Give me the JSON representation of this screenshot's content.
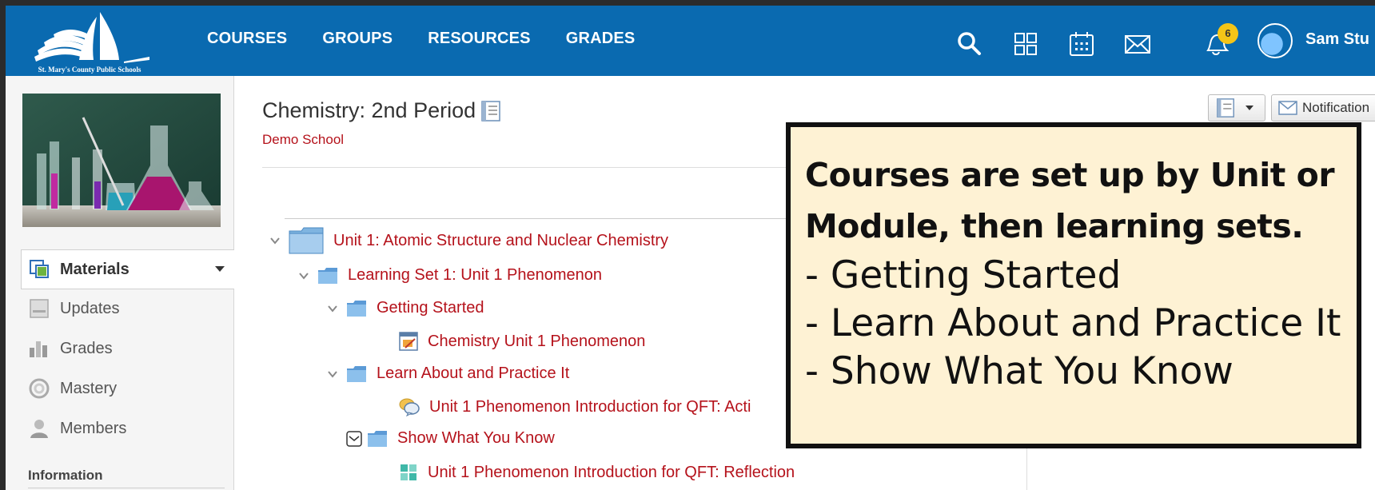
{
  "header": {
    "logo_text": "St. Mary's County Public Schools",
    "nav": [
      "COURSES",
      "GROUPS",
      "RESOURCES",
      "GRADES"
    ],
    "notification_count": "6",
    "user_name": "Sam Stu",
    "brand_color": "#0a6ab0",
    "icons": [
      "search-icon",
      "apps-grid-icon",
      "calendar-icon",
      "mail-icon",
      "bell-icon"
    ]
  },
  "sidebar": {
    "items": [
      {
        "label": "Materials",
        "icon": "materials-icon"
      },
      {
        "label": "Updates",
        "icon": "updates-icon"
      },
      {
        "label": "Grades",
        "icon": "grades-icon"
      },
      {
        "label": "Mastery",
        "icon": "mastery-icon"
      },
      {
        "label": "Members",
        "icon": "members-icon"
      }
    ],
    "info_label": "Information"
  },
  "course": {
    "title": "Chemistry: 2nd Period",
    "school": "Demo School",
    "notifications_button": "Notification"
  },
  "tree": [
    {
      "label": "Unit 1: Atomic Structure and Nuclear Chemistry",
      "type": "folder"
    },
    {
      "label": "Learning Set 1: Unit 1 Phenomenon",
      "type": "folder"
    },
    {
      "label": "Getting Started",
      "type": "folder"
    },
    {
      "label": "Chemistry Unit 1 Phenomenon",
      "type": "assignment"
    },
    {
      "label": "Learn About and Practice It",
      "type": "folder"
    },
    {
      "label": "Unit 1 Phenomenon Introduction for QFT: Acti",
      "type": "discussion"
    },
    {
      "label": "Show What You Know",
      "type": "folder"
    },
    {
      "label": "Unit 1 Phenomenon Introduction for QFT: Reflection",
      "type": "page"
    }
  ],
  "callout": {
    "heading_line1": "Courses are set up by Unit or",
    "heading_line2": "Module, then learning sets.",
    "bullets": [
      "- Getting Started",
      "- Learn About and Practice It",
      "- Show What You Know"
    ]
  },
  "colors": {
    "link_red": "#b5121b",
    "callout_bg": "#fef2d4"
  }
}
